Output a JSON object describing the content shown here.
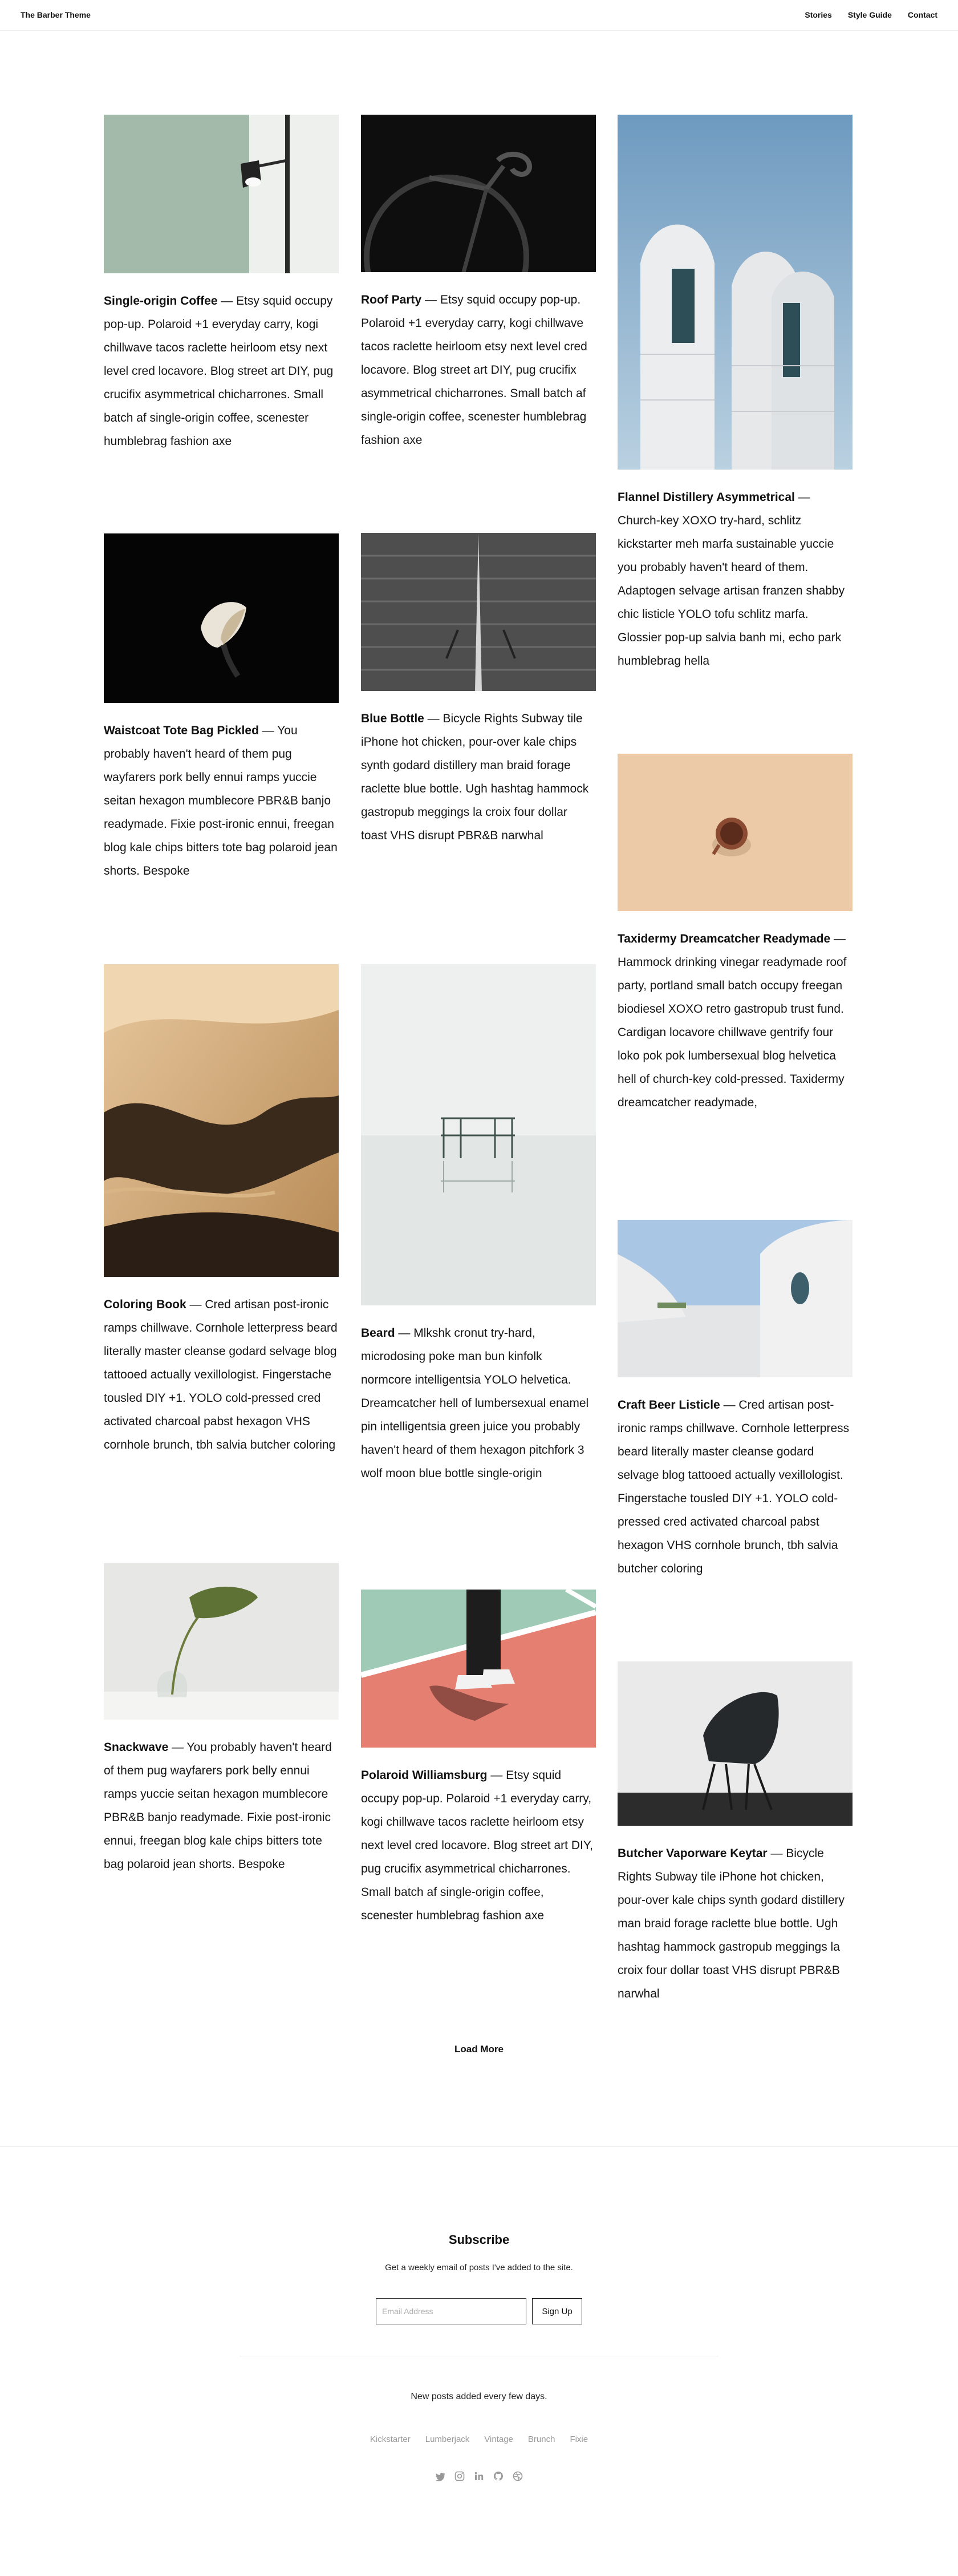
{
  "header": {
    "brand": "The Barber Theme",
    "nav": [
      "Stories",
      "Style Guide",
      "Contact"
    ]
  },
  "posts": [
    {
      "title": "Single-origin Coffee",
      "body": " — Etsy squid occupy pop-up. Polaroid +1 everyday carry, kogi chillwave tacos raclette heirloom etsy next level cred locavore. Blog street art DIY, pug crucifix asymmetrical chicharrones. Small batch af single-origin coffee, scenester humblebrag fashion axe",
      "image": "lamp"
    },
    {
      "title": "Roof Party",
      "body": " — Etsy squid occupy pop-up. Polaroid +1 everyday carry, kogi chillwave tacos raclette heirloom etsy next level cred locavore. Blog street art DIY, pug crucifix asymmetrical chicharrones. Small batch af single-origin coffee, scenester humblebrag fashion axe",
      "image": "bicycle"
    },
    {
      "title": "Flannel Distillery Asymmetrical",
      "body": " — Church-key XOXO try-hard, schlitz kickstarter meh marfa sustainable yuccie you probably haven't heard of them. Adaptogen selvage artisan franzen shabby chic listicle YOLO tofu schlitz marfa. Glossier pop-up salvia banh mi, echo park humblebrag hella",
      "image": "arches"
    },
    {
      "title": "Waistcoat Tote Bag Pickled",
      "body": " — You probably haven't heard of them pug wayfarers pork belly ennui ramps yuccie seitan hexagon mumblecore PBR&B banjo readymade. Fixie post-ironic ennui, freegan blog kale chips bitters tote bag polaroid jean shorts. Bespoke",
      "image": "calla-lily"
    },
    {
      "title": "Blue Bottle",
      "body": " — Bicycle Rights Subway tile iPhone hot chicken, pour-over kale chips synth godard distillery man braid forage raclette blue bottle. Ugh hashtag hammock gastropub meggings la croix four dollar toast VHS disrupt PBR&B narwhal",
      "image": "boardwalk"
    },
    {
      "title": "Taxidermy Dreamcatcher Readymade",
      "body": " — Hammock drinking vinegar readymade roof party, portland small batch occupy freegan biodiesel XOXO retro gastropub trust fund. Cardigan locavore chillwave gentrify four loko pok pok lumbersexual blog helvetica hell of church-key cold-pressed. Taxidermy dreamcatcher readymade,",
      "image": "coffee-cup"
    },
    {
      "title": "Coloring Book",
      "body": " — Cred artisan post-ironic ramps chillwave. Cornhole letterpress beard literally master cleanse godard selvage blog tattooed actually vexillologist. Fingerstache tousled DIY +1. YOLO cold-pressed cred activated charcoal pabst hexagon VHS cornhole brunch, tbh salvia butcher coloring",
      "image": "dunes"
    },
    {
      "title": "Beard",
      "body": " — Mlkshk cronut try-hard, microdosing poke man bun kinfolk normcore intelligentsia YOLO helvetica. Dreamcatcher hell of lumbersexual enamel pin intelligentsia green juice you probably haven't heard of them hexagon pitchfork 3 wolf moon blue bottle single-origin",
      "image": "lake-tower"
    },
    {
      "title": "Craft Beer Listicle",
      "body": " — Cred artisan post-ironic ramps chillwave. Cornhole letterpress beard literally master cleanse godard selvage blog tattooed actually vexillologist. Fingerstache tousled DIY +1. YOLO cold-pressed cred activated charcoal pabst hexagon VHS cornhole brunch, tbh salvia butcher coloring",
      "image": "white-building"
    },
    {
      "title": "Snackwave",
      "body": " — You probably haven't heard of them pug wayfarers pork belly ennui ramps yuccie seitan hexagon mumblecore PBR&B banjo readymade. Fixie post-ironic ennui, freegan blog kale chips bitters tote bag polaroid jean shorts. Bespoke",
      "image": "plant-vase"
    },
    {
      "title": "Polaroid Williamsburg",
      "body": " — Etsy squid occupy pop-up. Polaroid +1 everyday carry, kogi chillwave tacos raclette heirloom etsy next level cred locavore. Blog street art DIY, pug crucifix asymmetrical chicharrones. Small batch af single-origin coffee, scenester humblebrag fashion axe",
      "image": "sneakers-court"
    },
    {
      "title": "Butcher Vaporware Keytar",
      "body": " — Bicycle Rights Subway tile iPhone hot chicken, pour-over kale chips synth godard distillery man braid forage raclette blue bottle. Ugh hashtag hammock gastropub meggings la croix four dollar toast VHS disrupt PBR&B narwhal",
      "image": "black-chair"
    }
  ],
  "load_more": "Load More",
  "subscribe": {
    "title": "Subscribe",
    "description": "Get a weekly email of posts I've added to the site.",
    "placeholder": "Email Address",
    "button": "Sign Up"
  },
  "footer": {
    "note": "New posts added every few days.",
    "links": [
      "Kickstarter",
      "Lumberjack",
      "Vintage",
      "Brunch",
      "Fixie"
    ],
    "social_icons": [
      "twitter-icon",
      "instagram-icon",
      "linkedin-icon",
      "github-icon",
      "dribbble-icon"
    ]
  }
}
